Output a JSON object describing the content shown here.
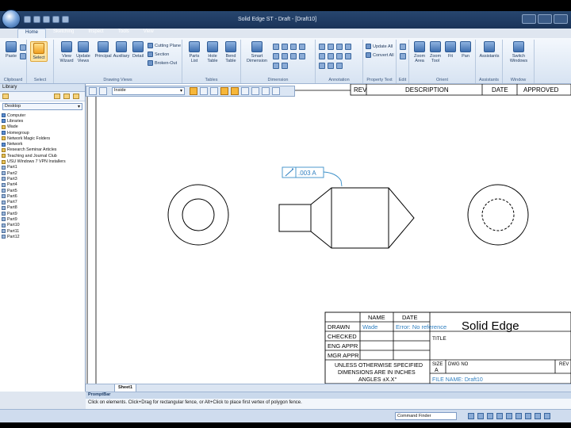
{
  "window": {
    "title": "Solid Edge ST - Draft - [Draft10]"
  },
  "tabs": [
    "Home",
    "Sketching",
    "Inspect",
    "Tools",
    "View"
  ],
  "ribbon": {
    "groups": [
      {
        "label": "Clipboard",
        "buttons": [
          "Paste"
        ]
      },
      {
        "label": "Select",
        "buttons": [
          "Select"
        ]
      },
      {
        "label": "Drawing Views",
        "buttons": [
          "View Wizard",
          "Update Views",
          "Principal",
          "Auxiliary",
          "Detail"
        ],
        "small": [
          "Cutting Plane",
          "Section",
          "Broken-Out"
        ]
      },
      {
        "label": "Tables",
        "buttons": [
          "Parts List",
          "Hole Table",
          "Bend Table"
        ]
      },
      {
        "label": "Dimension",
        "buttons": [
          "Smart Dimension"
        ]
      },
      {
        "label": "Annotation"
      },
      {
        "label": "Property Text",
        "small": [
          "Update All",
          "Convert All"
        ]
      },
      {
        "label": "Edit"
      },
      {
        "label": "Orient",
        "buttons": [
          "Zoom Area",
          "Zoom Tool",
          "Fit",
          "Pan"
        ]
      },
      {
        "label": "Assistants",
        "buttons": [
          "Assistants"
        ]
      },
      {
        "label": "Window",
        "buttons": [
          "Switch Windows"
        ]
      }
    ]
  },
  "library": {
    "header": "Library",
    "location": "Desktop",
    "items": [
      {
        "label": "Computer",
        "kind": "sys"
      },
      {
        "label": "Libraries",
        "kind": "sys"
      },
      {
        "label": "Wade",
        "kind": "folder"
      },
      {
        "label": "Homegroup",
        "kind": "sys"
      },
      {
        "label": "Network Magic Folders",
        "kind": "folder"
      },
      {
        "label": "Network",
        "kind": "sys"
      },
      {
        "label": "Research Seminar Articles",
        "kind": "folder"
      },
      {
        "label": "Teaching and Journal Club",
        "kind": "folder"
      },
      {
        "label": "USU Windows 7 VPN Installers",
        "kind": "folder"
      },
      {
        "label": "Part1",
        "kind": "part"
      },
      {
        "label": "Part2",
        "kind": "part"
      },
      {
        "label": "Part3",
        "kind": "part"
      },
      {
        "label": "Part4",
        "kind": "part"
      },
      {
        "label": "Part5",
        "kind": "part"
      },
      {
        "label": "Part6",
        "kind": "part"
      },
      {
        "label": "Part7",
        "kind": "part"
      },
      {
        "label": "Part8",
        "kind": "part"
      },
      {
        "label": "Part9",
        "kind": "part"
      },
      {
        "label": "Part9",
        "kind": "part"
      },
      {
        "label": "Part10",
        "kind": "part"
      },
      {
        "label": "Part11",
        "kind": "part"
      },
      {
        "label": "Part12",
        "kind": "part"
      }
    ]
  },
  "command_bar": {
    "select_value": "Inside"
  },
  "drawing": {
    "feature_control": ".003 A",
    "revision_table": {
      "headers": [
        "REV",
        "DESCRIPTION",
        "DATE",
        "APPROVED"
      ]
    },
    "title_block": {
      "col_name": "NAME",
      "col_date": "DATE",
      "rows": [
        "DRAWN",
        "CHECKED",
        "ENG APPR",
        "MGR APPR"
      ],
      "drawn_name": "Wade",
      "drawn_date": "Error: No reference",
      "company": "Solid Edge",
      "title_label": "TITLE",
      "tolerance_note": [
        "UNLESS OTHERWISE SPECIFIED",
        "DIMENSIONS ARE IN INCHES",
        "ANGLES ±X.X°"
      ],
      "size_label": "SIZE",
      "size_value": "A",
      "dwg_label": "DWG NO",
      "rev_label": "REV",
      "file_name": "FILE NAME: Draft10"
    }
  },
  "sheet_tab": "Sheet1",
  "prompt": {
    "header": "PromptBar",
    "text": "Click on elements. Click+Drag for rectangular fence, or Alt+Click to place first vertex of polygon fence."
  },
  "status": {
    "command_finder": "Command Finder"
  },
  "colors": {
    "ribbon": "#d7e3f2",
    "accent": "#f0a020",
    "link_text": "#2f7fc0"
  }
}
